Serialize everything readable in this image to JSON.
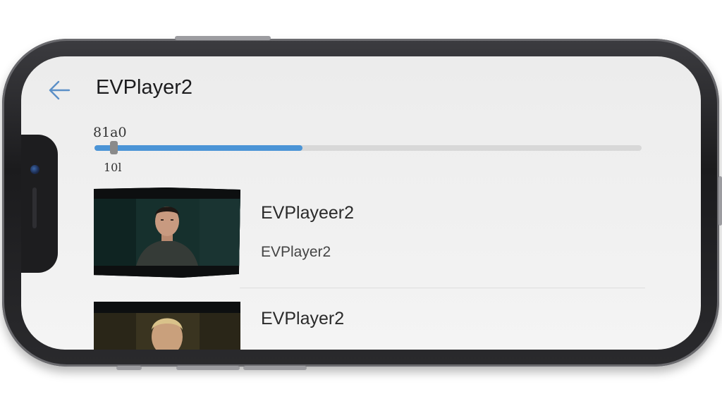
{
  "header": {
    "back_icon": "arrow-left-icon",
    "title": "EVPlayer2"
  },
  "player": {
    "time_label": "81a0",
    "sub_label": "10l",
    "progress": 0.38,
    "accent_color": "#4b94d6"
  },
  "videos": [
    {
      "title": "EVPlayeer2",
      "subtitle": "EVPlayer2"
    },
    {
      "title": "EVPlayer2",
      "subtitle": ""
    }
  ]
}
